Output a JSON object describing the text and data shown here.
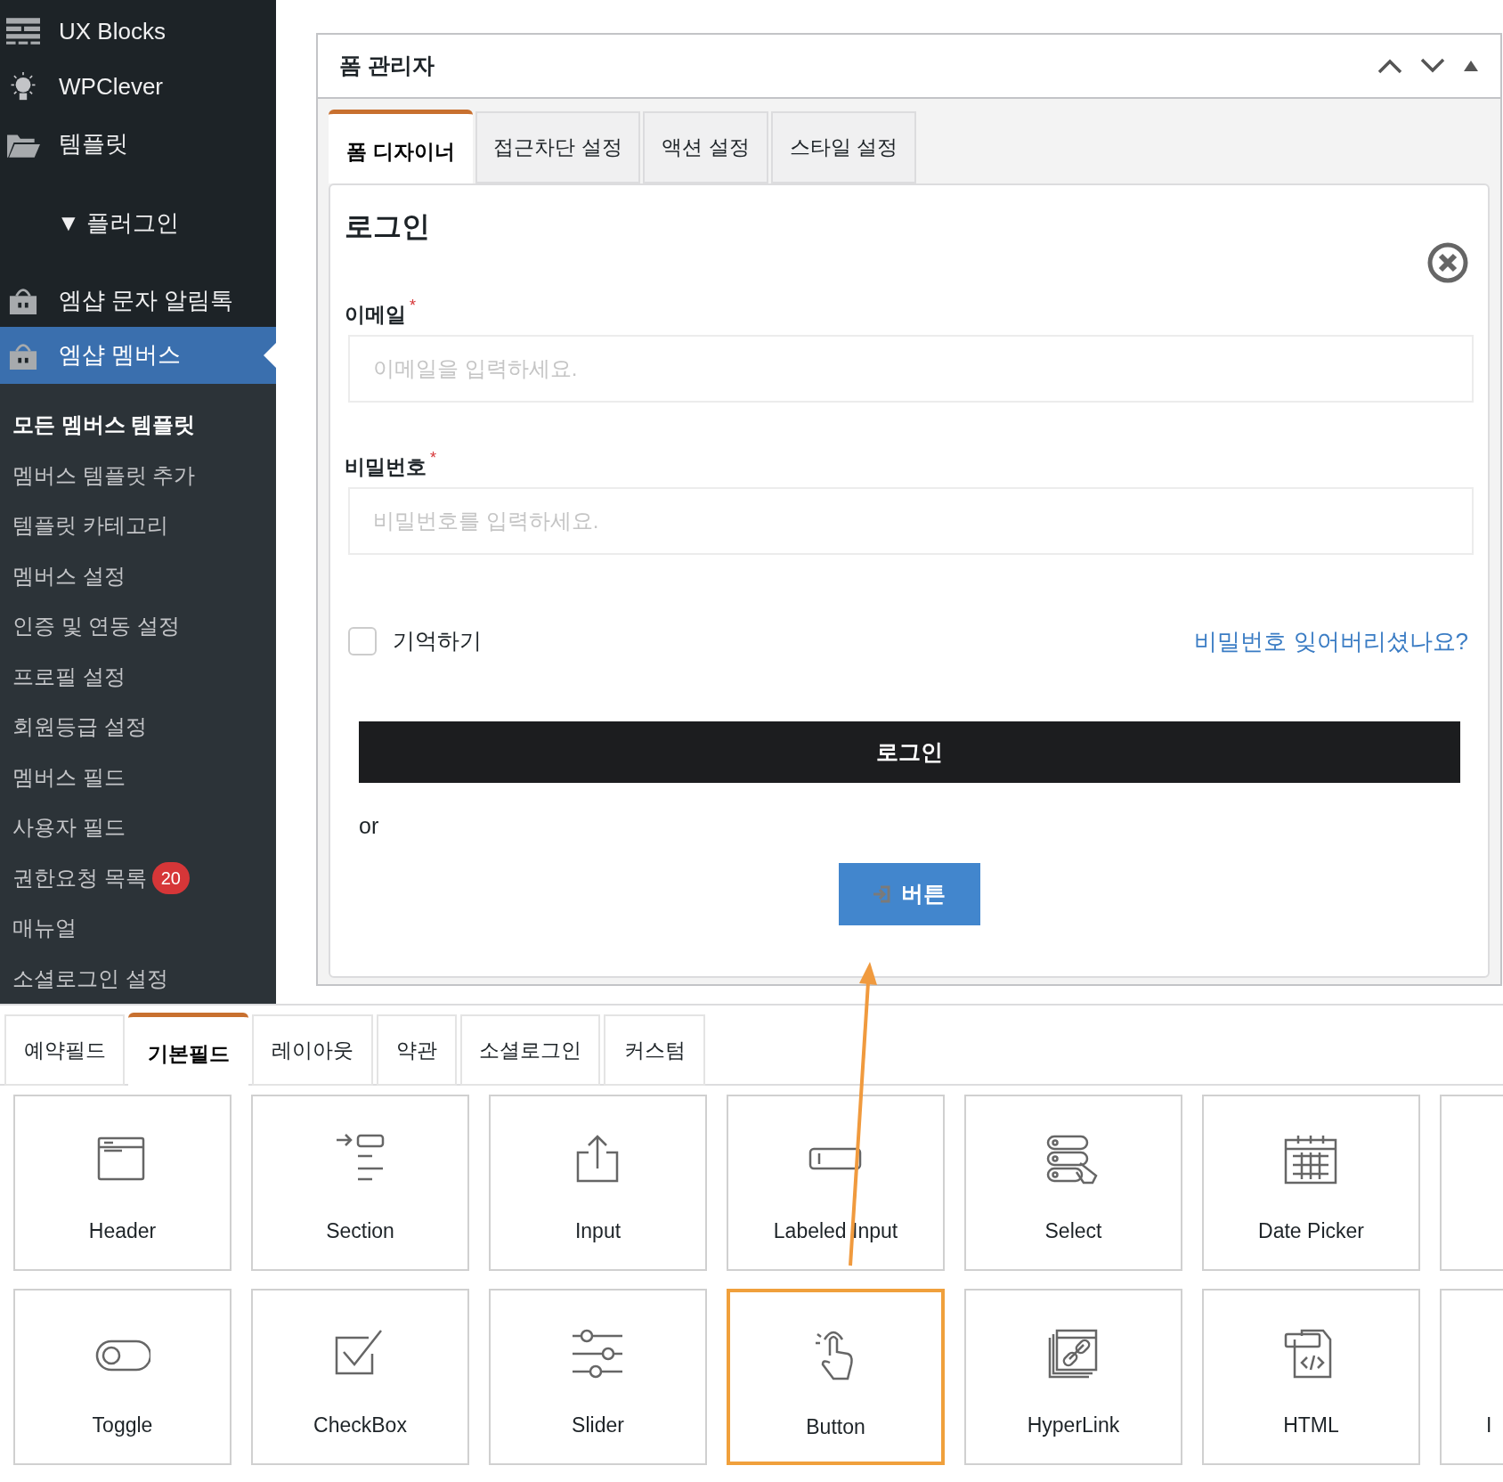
{
  "sidebar": {
    "items": [
      {
        "label": "UX Blocks",
        "kind": "menu",
        "selected": false
      },
      {
        "label": "WPClever",
        "kind": "menu",
        "selected": false
      },
      {
        "label": "템플릿",
        "kind": "menu",
        "selected": false
      },
      {
        "label": "▼ 플러그인",
        "kind": "group"
      },
      {
        "label": "엠샵 문자 알림톡",
        "kind": "menu",
        "selected": false
      },
      {
        "label": "엠샵 멤버스",
        "kind": "menu",
        "selected": true
      }
    ],
    "submenu": [
      {
        "label": "모든 멤버스 템플릿",
        "selected": true
      },
      {
        "label": "멤버스 템플릿 추가",
        "selected": false
      },
      {
        "label": "템플릿 카테고리",
        "selected": false
      },
      {
        "label": "멤버스 설정",
        "selected": false
      },
      {
        "label": "인증 및 연동 설정",
        "selected": false
      },
      {
        "label": "프로필 설정",
        "selected": false
      },
      {
        "label": "회원등급 설정",
        "selected": false
      },
      {
        "label": "멤버스 필드",
        "selected": false
      },
      {
        "label": "사용자 필드",
        "selected": false
      },
      {
        "label": "권한요청 목록",
        "badge": "20",
        "selected": false
      },
      {
        "label": "매뉴얼",
        "selected": false
      },
      {
        "label": "소셜로그인 설정",
        "selected": false
      }
    ]
  },
  "form_manager": {
    "title": "폼 관리자",
    "tabs": [
      {
        "label": "폼 디자이너",
        "selected": true
      },
      {
        "label": "접근차단 설정",
        "selected": false
      },
      {
        "label": "액션 설정",
        "selected": false
      },
      {
        "label": "스타일 설정",
        "selected": false
      }
    ],
    "form": {
      "title": "로그인",
      "fields": [
        {
          "label": "이메일",
          "required_mark": "*",
          "placeholder": "이메일을 입력하세요."
        },
        {
          "label": "비밀번호",
          "required_mark": "*",
          "placeholder": "비밀번호를 입력하세요."
        }
      ],
      "remember": {
        "label": "기억하기",
        "checked": false
      },
      "forgot_link": "비밀번호 잊어버리셨나요?",
      "submit": "로그인",
      "separator": "or",
      "extra_button": "버튼"
    }
  },
  "field_palette": {
    "tabs": [
      {
        "label": "예약필드",
        "selected": false
      },
      {
        "label": "기본필드",
        "selected": true
      },
      {
        "label": "레이아웃",
        "selected": false
      },
      {
        "label": "약관",
        "selected": false
      },
      {
        "label": "소셜로그인",
        "selected": false
      },
      {
        "label": "커스텀",
        "selected": false
      }
    ],
    "tiles": [
      {
        "label": "Header",
        "kind": "tile",
        "selected": false
      },
      {
        "label": "Section",
        "kind": "tile",
        "selected": false
      },
      {
        "label": "Input",
        "kind": "tile",
        "selected": false
      },
      {
        "label": "Labeled Input",
        "kind": "tile",
        "selected": false
      },
      {
        "label": "Select",
        "kind": "tile",
        "selected": false
      },
      {
        "label": "Date Picker",
        "kind": "tile",
        "selected": false
      },
      {
        "kind": "partial",
        "selected": false
      },
      {
        "label": "Toggle",
        "kind": "tile",
        "selected": false
      },
      {
        "label": "CheckBox",
        "kind": "tile",
        "selected": false
      },
      {
        "label": "Slider",
        "kind": "tile",
        "selected": false
      },
      {
        "label": "Button",
        "kind": "tile",
        "selected": true
      },
      {
        "label": "HyperLink",
        "kind": "tile",
        "selected": false
      },
      {
        "label": "HTML",
        "kind": "tile",
        "selected": false
      },
      {
        "label": "I",
        "kind": "partial",
        "selected": false
      }
    ]
  }
}
